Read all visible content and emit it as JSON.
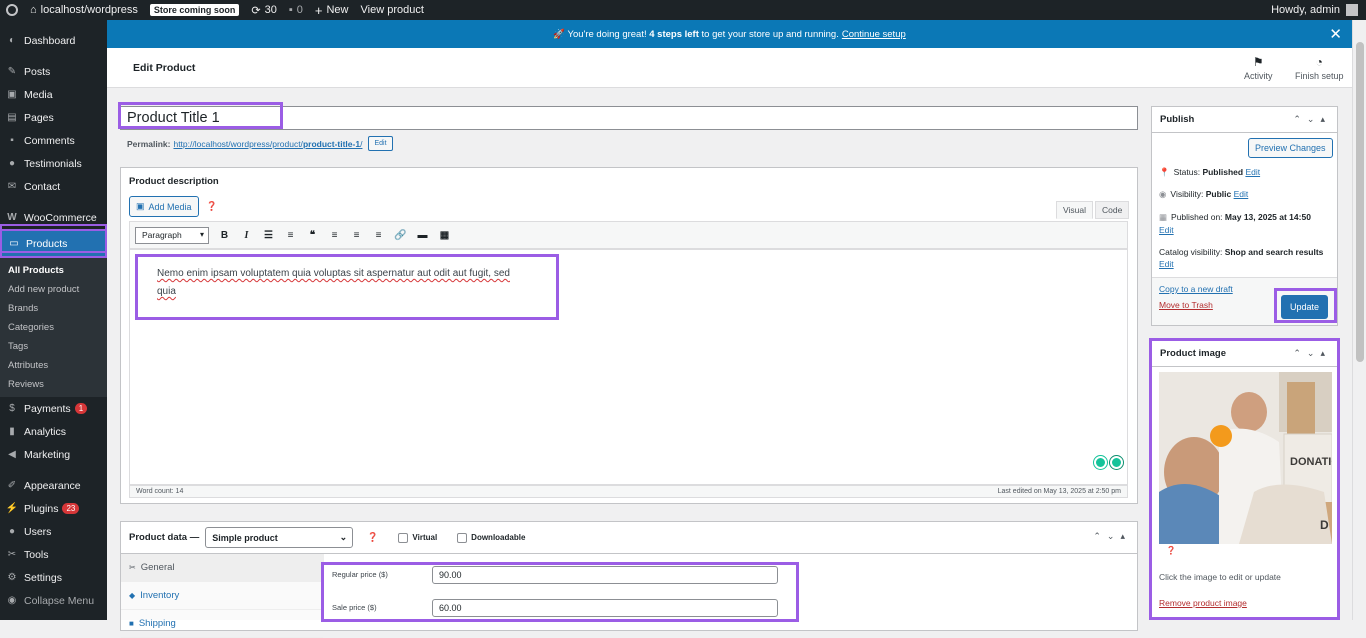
{
  "admin_bar": {
    "site_name": "localhost/wordpress",
    "store_badge": "Store coming soon",
    "updates_count": "30",
    "comments_count": "0",
    "new_label": "New",
    "view_product": "View product",
    "howdy": "Howdy, admin"
  },
  "sidebar": {
    "items": [
      {
        "label": "Dashboard",
        "icon": "dashboard-icon"
      },
      {
        "label": "Posts",
        "icon": "pin-icon"
      },
      {
        "label": "Media",
        "icon": "media-icon"
      },
      {
        "label": "Pages",
        "icon": "pages-icon"
      },
      {
        "label": "Comments",
        "icon": "comment-icon"
      },
      {
        "label": "Testimonials",
        "icon": "person-icon"
      },
      {
        "label": "Contact",
        "icon": "mail-icon"
      },
      {
        "label": "WooCommerce",
        "icon": "woo-icon"
      },
      {
        "label": "Products",
        "icon": "archive-icon"
      },
      {
        "label": "Payments",
        "icon": "payment-icon",
        "count": "1"
      },
      {
        "label": "Analytics",
        "icon": "chart-icon"
      },
      {
        "label": "Marketing",
        "icon": "megaphone-icon"
      },
      {
        "label": "Appearance",
        "icon": "brush-icon"
      },
      {
        "label": "Plugins",
        "icon": "plug-icon",
        "count": "23"
      },
      {
        "label": "Users",
        "icon": "users-icon"
      },
      {
        "label": "Tools",
        "icon": "wrench-icon"
      },
      {
        "label": "Settings",
        "icon": "settings-icon"
      },
      {
        "label": "Collapse Menu",
        "icon": "collapse-icon"
      }
    ],
    "submenu": [
      "All Products",
      "Add new product",
      "Brands",
      "Categories",
      "Tags",
      "Attributes",
      "Reviews"
    ]
  },
  "notice": {
    "prefix": "🚀 You're doing great!",
    "bold": "4 steps left",
    "suffix": "to get your store up and running.",
    "link": "Continue setup"
  },
  "header": {
    "title": "Edit Product",
    "activity": "Activity",
    "finish_setup": "Finish setup"
  },
  "product": {
    "title": "Product Title 1",
    "permalink_label": "Permalink:",
    "permalink_base": "http://localhost/wordpress/product/",
    "permalink_slug": "product-title-1",
    "permalink_end": "/",
    "permalink_edit": "Edit"
  },
  "description": {
    "heading": "Product description",
    "add_media": "Add Media",
    "tab_visual": "Visual",
    "tab_code": "Code",
    "format": "Paragraph",
    "text_line1": "Nemo enim ipsam voluptatem quia voluptas sit aspernatur aut odit aut fugit, sed",
    "text_line2": "quia",
    "word_count": "Word count: 14",
    "last_edited": "Last edited on May 13, 2025 at 2:50 pm"
  },
  "product_data": {
    "heading": "Product data —",
    "type": "Simple product",
    "virtual": "Virtual",
    "downloadable": "Downloadable",
    "tabs": [
      "General",
      "Inventory",
      "Shipping"
    ],
    "regular_price_label": "Regular price ($)",
    "regular_price": "90.00",
    "sale_price_label": "Sale price ($)",
    "sale_price": "60.00"
  },
  "publish": {
    "heading": "Publish",
    "preview": "Preview Changes",
    "status_label": "Status:",
    "status": "Published",
    "visibility_label": "Visibility:",
    "visibility": "Public",
    "published_label": "Published on:",
    "published": "May 13, 2025 at 14:50",
    "catalog_label": "Catalog visibility:",
    "catalog": "Shop and search results",
    "edit": "Edit",
    "copy_draft": "Copy to a new draft",
    "trash": "Move to Trash",
    "update": "Update"
  },
  "product_image": {
    "heading": "Product image",
    "hint": "Click the image to edit or update",
    "remove": "Remove product image",
    "box_text": "DONATIO",
    "box_text2": "D"
  },
  "colors": {
    "admin_bar": "#1d2327",
    "accent": "#2271b1",
    "notice": "#0b78b6",
    "highlight": "#9b5de5"
  }
}
